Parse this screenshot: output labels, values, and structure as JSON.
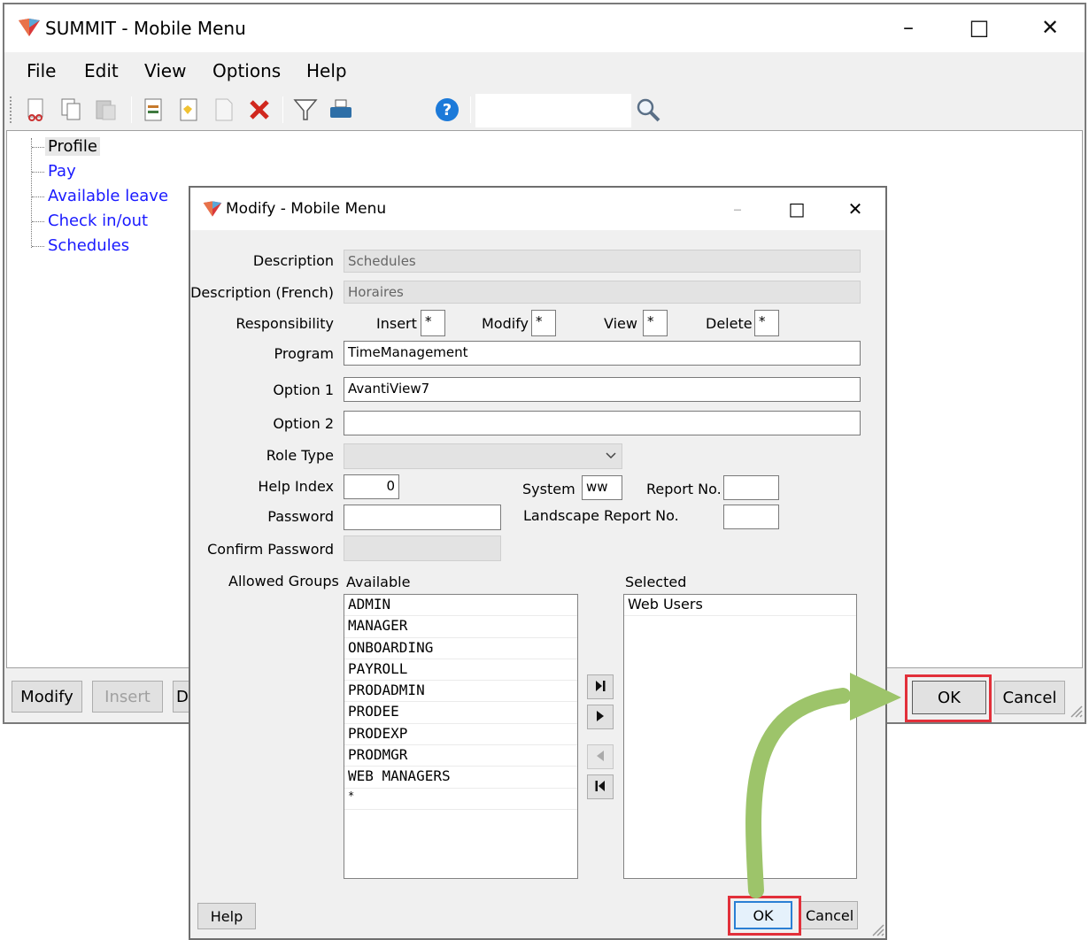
{
  "main_window": {
    "title": "SUMMIT - Mobile Menu",
    "menu": [
      "File",
      "Edit",
      "View",
      "Options",
      "Help"
    ],
    "tree": [
      "Profile",
      "Pay",
      "Available leave",
      "Check in/out",
      "Schedules"
    ],
    "bottom_buttons": {
      "modify": "Modify",
      "insert": "Insert",
      "delete_partial": "D",
      "ok": "OK",
      "cancel": "Cancel"
    }
  },
  "dialog": {
    "title": "Modify - Mobile Menu",
    "labels": {
      "description": "Description",
      "description_french": "Description (French)",
      "responsibility": "Responsibility",
      "insert": "Insert",
      "modify": "Modify",
      "view": "View",
      "delete": "Delete",
      "program": "Program",
      "option1": "Option 1",
      "option2": "Option 2",
      "role_type": "Role Type",
      "help_index": "Help Index",
      "system": "System",
      "report_no": "Report No.",
      "password": "Password",
      "landscape_report_no": "Landscape Report No.",
      "confirm_password": "Confirm Password",
      "allowed_groups": "Allowed Groups",
      "available": "Available",
      "selected": "Selected"
    },
    "values": {
      "description": "Schedules",
      "description_french": "Horaires",
      "insert": "*",
      "modify": "*",
      "view": "*",
      "delete": "*",
      "program": "TimeManagement",
      "option1": "AvantiView7",
      "option2": "",
      "role_type": "",
      "help_index": "0",
      "system": "ww",
      "report_no": "",
      "password": "",
      "landscape_report_no": "",
      "confirm_password": ""
    },
    "available_groups": [
      "ADMIN",
      "MANAGER",
      "ONBOARDING",
      "PAYROLL",
      "PRODADMIN",
      "PRODEE",
      "PRODEXP",
      "PRODMGR",
      "WEB MANAGERS",
      "*"
    ],
    "selected_groups": [
      "Web Users"
    ],
    "buttons": {
      "help": "Help",
      "ok": "OK",
      "cancel": "Cancel"
    }
  },
  "colors": {
    "highlight": "#e2303a",
    "arrow": "#9dc46a",
    "link": "#1a1aff"
  }
}
